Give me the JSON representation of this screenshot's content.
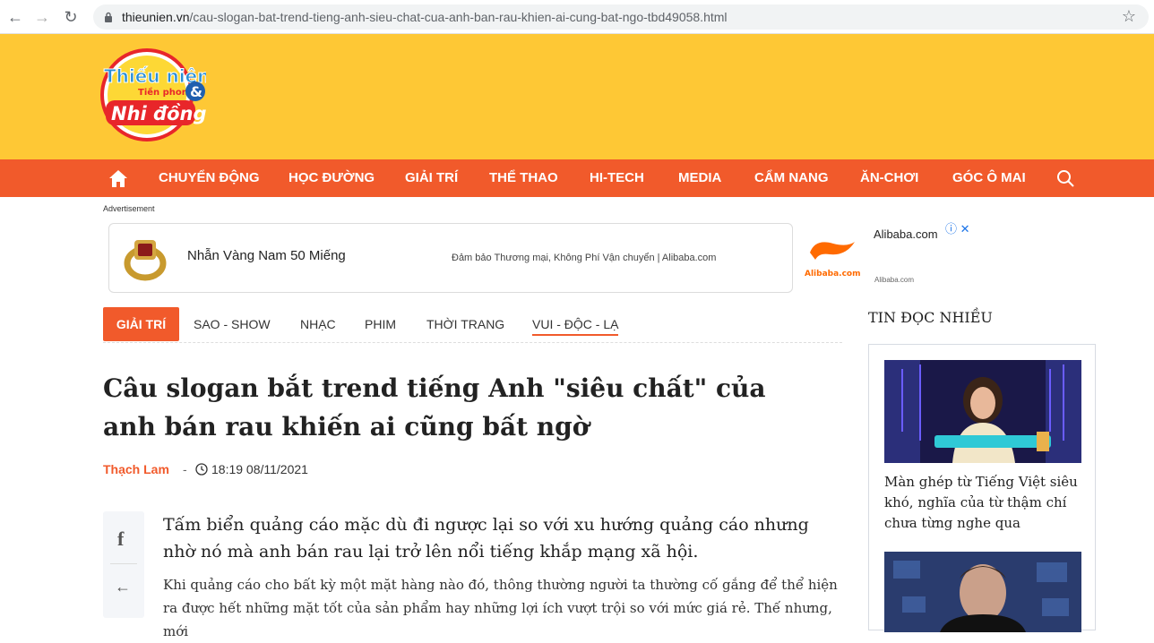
{
  "browser": {
    "url_domain": "thieunien.vn",
    "url_path": "/cau-slogan-bat-trend-tieng-anh-sieu-chat-cua-anh-ban-rau-khien-ai-cung-bat-ngo-tbd49058.html"
  },
  "site": {
    "logo_text_top": "Thiếu niên",
    "logo_text_mid": "Tiền phong",
    "logo_text_bottom": "Nhi đồng"
  },
  "nav": {
    "items": [
      "CHUYỂN ĐỘNG",
      "HỌC ĐƯỜNG",
      "GIẢI TRÍ",
      "THỂ THAO",
      "HI-TECH",
      "MEDIA",
      "CẨM NANG",
      "ĂN-CHƠI",
      "GÓC Ô MAI"
    ]
  },
  "ad": {
    "label": "Advertisement",
    "title": "Nhẫn Vàng Nam 50 Miếng",
    "desc": "Đảm bảo Thương mại, Không Phí Vận chuyển | Alibaba.com",
    "brand_name": "Alibaba.com",
    "brand_url": "Alibaba.com",
    "brand_logo_text": "Alibaba.com"
  },
  "subnav": {
    "active": "GIẢI TRÍ",
    "items": [
      "SAO - SHOW",
      "NHẠC",
      "PHIM",
      "THỜI TRANG",
      "VUI - ĐỘC - LẠ"
    ]
  },
  "article": {
    "title": "Câu slogan bắt trend tiếng Anh \"siêu chất\" của anh bán rau khiến ai cũng bất ngờ",
    "author": "Thạch Lam",
    "separator": "-",
    "time": "18:19 08/11/2021",
    "sapo": "Tấm biển quảng cáo mặc dù đi ngược lại so với xu hướng quảng cáo nhưng nhờ nó mà anh bán rau lại trở lên nổi tiếng khắp mạng xã hội.",
    "body": "Khi quảng cáo cho bất kỳ một mặt hàng nào đó, thông thường người ta thường cố gắng để thể hiện ra được hết những mặt tốt của sản phẩm hay những lợi ích vượt trội so với mức giá rẻ. Thế nhưng, mới"
  },
  "sidebar": {
    "heading": "TIN ĐỌC NHIỀU",
    "items": [
      {
        "caption": "Màn ghép từ Tiếng Việt siêu khó, nghĩa của từ thậm chí chưa từng nghe qua"
      }
    ]
  },
  "colors": {
    "accent": "#f15a2b",
    "header_bg": "#fec835"
  }
}
